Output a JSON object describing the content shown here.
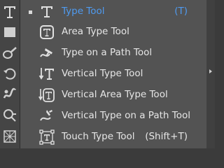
{
  "toolbar": {
    "tools": [
      {
        "icon": "type-tool-icon"
      },
      {
        "icon": "rectangle-tool-icon"
      },
      {
        "icon": "blob-brush-tool-icon"
      },
      {
        "icon": "rotate-tool-icon"
      },
      {
        "icon": "warp-tool-icon"
      },
      {
        "icon": "shape-builder-tool-icon"
      },
      {
        "icon": "perspective-grid-tool-icon"
      }
    ]
  },
  "flyout": {
    "items": [
      {
        "label": "Type Tool",
        "shortcut": "(T)",
        "icon": "type-tool-icon",
        "selected": true
      },
      {
        "label": "Area Type Tool",
        "shortcut": "",
        "icon": "area-type-tool-icon",
        "selected": false
      },
      {
        "label": "Type on a Path Tool",
        "shortcut": "",
        "icon": "type-on-path-tool-icon",
        "selected": false
      },
      {
        "label": "Vertical Type Tool",
        "shortcut": "",
        "icon": "vertical-type-tool-icon",
        "selected": false
      },
      {
        "label": "Vertical Area Type Tool",
        "shortcut": "",
        "icon": "vertical-area-type-tool-icon",
        "selected": false
      },
      {
        "label": "Vertical Type on a Path Tool",
        "shortcut": "",
        "icon": "vertical-type-on-path-tool-icon",
        "selected": false
      },
      {
        "label": "Touch Type Tool",
        "shortcut": "(Shift+T)",
        "icon": "touch-type-tool-icon",
        "selected": false
      }
    ]
  },
  "colors": {
    "selected_text": "#4f9bf0",
    "menu_text": "#e6e6e6",
    "menu_bg": "#535353",
    "toolbar_bg": "#454545"
  }
}
